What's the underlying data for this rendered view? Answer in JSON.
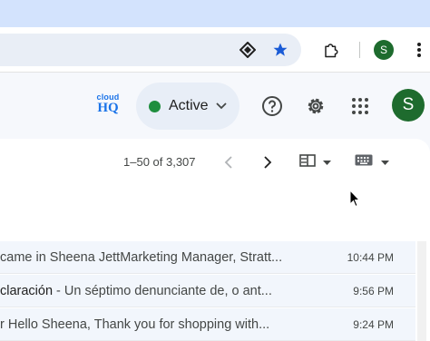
{
  "browser": {
    "profile_initial": "S",
    "icons": [
      "site-permissions-icon",
      "bookmark-star-icon",
      "extensions-icon",
      "more-vert-icon"
    ]
  },
  "header": {
    "logo": {
      "line1": "cloud",
      "line2": "HQ"
    },
    "status": {
      "label": "Active",
      "color": "#1e8e3e"
    },
    "avatar_initial": "S"
  },
  "toolbar": {
    "pagination": "1–50 of 3,307"
  },
  "emails": [
    {
      "subject": "",
      "snippet": "came in Sheena JettMarketing Manager, Stratt...",
      "time": "10:44 PM"
    },
    {
      "subject": "claración",
      "snippet": " - Un séptimo denunciante de, o ant...",
      "time": "9:56 PM"
    },
    {
      "subject": "",
      "snippet": "r Hello Sheena, Thank you for shopping with...",
      "time": "9:24 PM"
    }
  ],
  "colors": {
    "accent": "#1a73e8",
    "status_green": "#1e8e3e",
    "avatar_green": "#1e6b2e"
  }
}
